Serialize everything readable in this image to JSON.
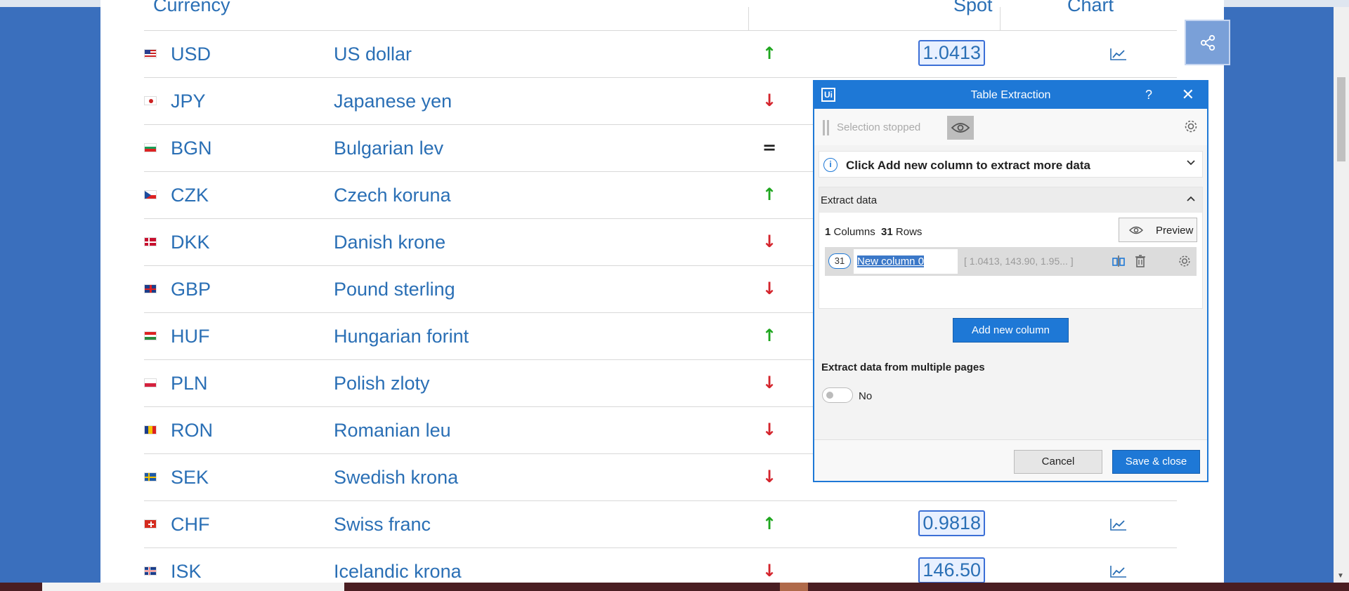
{
  "table": {
    "headers": {
      "currency": "Currency",
      "spot": "Spot",
      "chart": "Chart"
    },
    "rows": [
      {
        "code": "USD",
        "name": "US dollar",
        "trend": "↑",
        "trend_kind": "up",
        "spot": "1.0413",
        "flag": "us"
      },
      {
        "code": "JPY",
        "name": "Japanese yen",
        "trend": "↓",
        "trend_kind": "down",
        "spot": "",
        "flag": "jp"
      },
      {
        "code": "BGN",
        "name": "Bulgarian lev",
        "trend": "=",
        "trend_kind": "eq",
        "spot": "",
        "flag": "bg"
      },
      {
        "code": "CZK",
        "name": "Czech koruna",
        "trend": "↑",
        "trend_kind": "up",
        "spot": "",
        "flag": "cz"
      },
      {
        "code": "DKK",
        "name": "Danish krone",
        "trend": "↓",
        "trend_kind": "down",
        "spot": "",
        "flag": "dk"
      },
      {
        "code": "GBP",
        "name": "Pound sterling",
        "trend": "↓",
        "trend_kind": "down",
        "spot": "",
        "flag": "gb"
      },
      {
        "code": "HUF",
        "name": "Hungarian forint",
        "trend": "↑",
        "trend_kind": "up",
        "spot": "",
        "flag": "hu"
      },
      {
        "code": "PLN",
        "name": "Polish zloty",
        "trend": "↓",
        "trend_kind": "down",
        "spot": "",
        "flag": "pl"
      },
      {
        "code": "RON",
        "name": "Romanian leu",
        "trend": "↓",
        "trend_kind": "down",
        "spot": "",
        "flag": "ro"
      },
      {
        "code": "SEK",
        "name": "Swedish krona",
        "trend": "↓",
        "trend_kind": "down",
        "spot": "",
        "flag": "se"
      },
      {
        "code": "CHF",
        "name": "Swiss franc",
        "trend": "↑",
        "trend_kind": "up",
        "spot": "0.9818",
        "flag": "ch"
      },
      {
        "code": "ISK",
        "name": "Icelandic krona",
        "trend": "↓",
        "trend_kind": "down",
        "spot": "146.50",
        "flag": "is"
      }
    ]
  },
  "share_icon": "share-icon",
  "dialog": {
    "logo": "Ui",
    "title": "Table Extraction",
    "help": "?",
    "close": "✕",
    "selection_status": "Selection stopped",
    "info_text": "Click Add new column to extract more data",
    "section_title": "Extract data",
    "columns_count": "1",
    "columns_label": "Columns",
    "rows_count": "31",
    "rows_label": "Rows",
    "preview_label": "Preview",
    "column": {
      "count": "31",
      "name": "New column 0",
      "sample": "[ 1.0413, 143.90, 1.95... ]"
    },
    "add_column_label": "Add new column",
    "multi_pages_label": "Extract data from multiple pages",
    "toggle_label": "No",
    "cancel_label": "Cancel",
    "save_label": "Save & close"
  },
  "colors": {
    "accent": "#1e78d6",
    "link": "#2a6fb5",
    "trend_up": "#1ea61e",
    "trend_down": "#d4242c",
    "background": "#3a6fbd"
  }
}
